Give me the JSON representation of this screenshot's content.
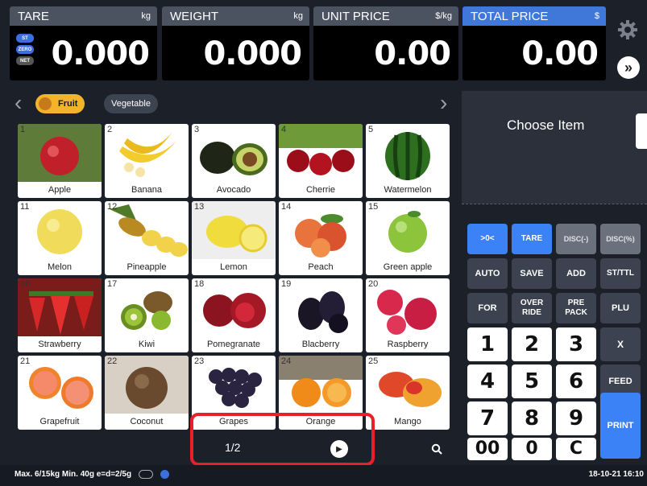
{
  "displays": {
    "tare": {
      "label": "TARE",
      "unit": "kg",
      "value": "0.000"
    },
    "weight": {
      "label": "WEIGHT",
      "unit": "kg",
      "value": "0.000"
    },
    "unit_price": {
      "label": "UNIT PRICE",
      "unit": "$/kg",
      "value": "0.00"
    },
    "total_price": {
      "label": "TOTAL PRICE",
      "unit": "$",
      "value": "0.00"
    }
  },
  "indicators": [
    "ST",
    "ZERO",
    "NET"
  ],
  "expand_button": "»",
  "categories": [
    {
      "label": "Fruit",
      "selected": true
    },
    {
      "label": "Vegetable",
      "selected": false
    }
  ],
  "products": [
    {
      "num": "1",
      "name": "Apple"
    },
    {
      "num": "2",
      "name": "Banana"
    },
    {
      "num": "3",
      "name": "Avocado"
    },
    {
      "num": "4",
      "name": "Cherrie"
    },
    {
      "num": "5",
      "name": "Watermelon"
    },
    {
      "num": "11",
      "name": "Melon"
    },
    {
      "num": "12",
      "name": "Pineapple"
    },
    {
      "num": "13",
      "name": "Lemon"
    },
    {
      "num": "14",
      "name": "Peach"
    },
    {
      "num": "15",
      "name": "Green apple"
    },
    {
      "num": "16",
      "name": "Strawberry"
    },
    {
      "num": "17",
      "name": "Kiwi"
    },
    {
      "num": "18",
      "name": "Pomegranate"
    },
    {
      "num": "19",
      "name": "Blacberry"
    },
    {
      "num": "20",
      "name": "Raspberry"
    },
    {
      "num": "21",
      "name": "Grapefruit"
    },
    {
      "num": "22",
      "name": "Coconut"
    },
    {
      "num": "23",
      "name": "Grapes"
    },
    {
      "num": "24",
      "name": "Orange"
    },
    {
      "num": "25",
      "name": "Mango"
    }
  ],
  "pager": {
    "text": "1/2"
  },
  "chooser": {
    "text": "Choose Item"
  },
  "keys": {
    "zero": ">0<",
    "tare": "TARE",
    "disc_minus": "DISC(-)",
    "disc_pct": "DISC(%)",
    "auto": "AUTO",
    "save": "SAVE",
    "add": "ADD",
    "sttl": "ST/TTL",
    "for": "FOR",
    "override": "OVER RIDE",
    "prepack": "PRE PACK",
    "plu": "PLU",
    "d1": "1",
    "d2": "2",
    "d3": "3",
    "x": "X",
    "d4": "4",
    "d5": "5",
    "d6": "6",
    "feed": "FEED",
    "d7": "7",
    "d8": "8",
    "d9": "9",
    "print": "PRINT",
    "d00": "00",
    "d0": "0",
    "clear": "C"
  },
  "status": {
    "specs": "Max. 6/15kg  Min. 40g  e=d=2/5g",
    "datetime": "18-10-21 16:10"
  },
  "colors": {
    "accent": "#3b82f6",
    "fruit_chip": "#f3b42c",
    "highlight": "#e8202a"
  }
}
